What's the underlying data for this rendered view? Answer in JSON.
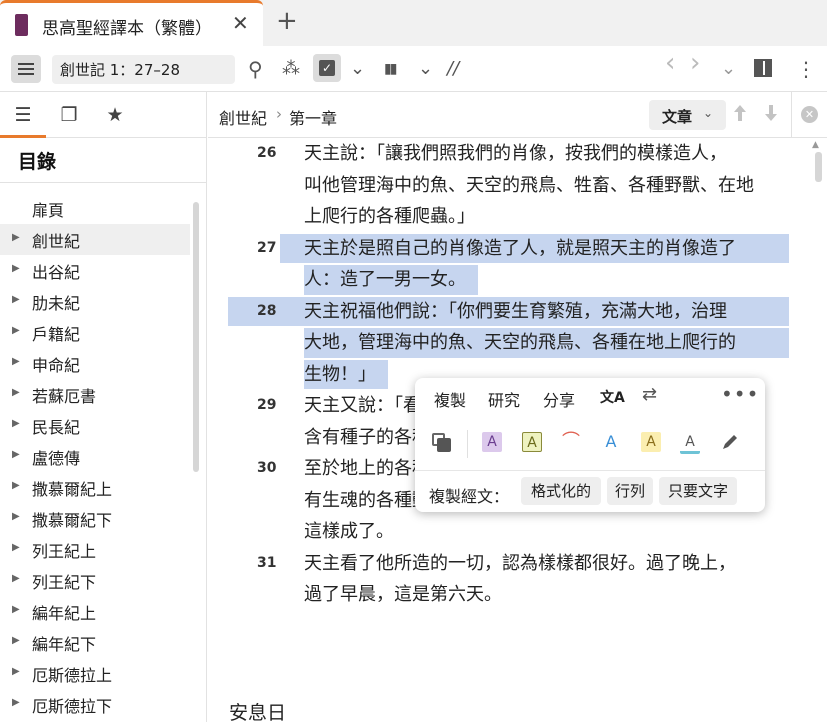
{
  "tab": {
    "title": "思高聖經譯本（繁體）",
    "close": "✕",
    "new": "+"
  },
  "toolbar": {
    "reference_value": "創世記 1：27–28",
    "search_icon": "⚲",
    "visual_icon": "⁂",
    "check_icon": "✓",
    "dropdown_icon": "⌄",
    "parallel_icon": "▮▮",
    "interlinear_label": "//",
    "back_icon": "‹",
    "forward_icon": "›",
    "more_icon": "⋮"
  },
  "sidebar": {
    "tabs": [
      {
        "name": "toc",
        "glyph": "☰"
      },
      {
        "name": "copies",
        "glyph": "❐"
      },
      {
        "name": "favorites",
        "glyph": "★"
      }
    ],
    "title": "目錄",
    "items": [
      {
        "label": "扉頁",
        "expandable": false,
        "selected": false
      },
      {
        "label": "創世紀",
        "expandable": true,
        "selected": true
      },
      {
        "label": "出谷紀",
        "expandable": true,
        "selected": false
      },
      {
        "label": "肋未紀",
        "expandable": true,
        "selected": false
      },
      {
        "label": "戶籍紀",
        "expandable": true,
        "selected": false
      },
      {
        "label": "申命紀",
        "expandable": true,
        "selected": false
      },
      {
        "label": "若蘇厄書",
        "expandable": true,
        "selected": false
      },
      {
        "label": "民長紀",
        "expandable": true,
        "selected": false
      },
      {
        "label": "盧德傳",
        "expandable": true,
        "selected": false
      },
      {
        "label": "撒慕爾紀上",
        "expandable": true,
        "selected": false
      },
      {
        "label": "撒慕爾紀下",
        "expandable": true,
        "selected": false
      },
      {
        "label": "列王紀上",
        "expandable": true,
        "selected": false
      },
      {
        "label": "列王紀下",
        "expandable": true,
        "selected": false
      },
      {
        "label": "編年紀上",
        "expandable": true,
        "selected": false
      },
      {
        "label": "編年紀下",
        "expandable": true,
        "selected": false
      },
      {
        "label": "厄斯德拉上",
        "expandable": true,
        "selected": false
      },
      {
        "label": "厄斯德拉下",
        "expandable": true,
        "selected": false
      }
    ]
  },
  "reader": {
    "breadcrumb_book": "創世紀",
    "breadcrumb_sep": "›",
    "breadcrumb_chapter": "第一章",
    "view_type": "文章",
    "verses": [
      {
        "num": "26",
        "lines": [
          "天主說：「讓我們照我們的肖像，按我們的模樣造人，",
          "叫他管理海中的魚、天空的飛鳥、牲畜、各種野獸、在地",
          "上爬行的各種爬蟲。」"
        ],
        "highlight": false
      },
      {
        "num": "27",
        "lines": [
          "天主於是照自己的肖像造了人，就是照天主的肖像造了",
          "人：造了一男一女。"
        ],
        "highlight": true
      },
      {
        "num": "28",
        "lines": [
          "天主祝福他們說：「你們要生育繁殖，充滿大地，治理",
          "大地，管理海中的魚、天空的飛鳥、各種在地上爬行的",
          "生物！」"
        ],
        "highlight": true
      },
      {
        "num": "29",
        "lines": [
          "天主又說：「看，全地面上結種子的各種蔬菜，在果內",
          "含有種子的各種果樹，我都給你們作食物；"
        ],
        "highlight": false
      },
      {
        "num": "30",
        "lines": [
          "至於地上的各種野獸，天空的各種飛鳥，在地上爬行",
          "有生魂的各種動物，我把一切青草給牠們作食物。」事就",
          "這樣成了。"
        ],
        "highlight": false
      },
      {
        "num": "31",
        "lines": [
          "天主看了他所造的一切，認為樣樣都很好。過了晚上，",
          "過了早晨，這是第六天。"
        ],
        "highlight": false
      }
    ],
    "section_heading": "安息日"
  },
  "popup": {
    "copy": "複製",
    "research": "研究",
    "share": "分享",
    "translate_icon": "文A",
    "swap_icon": "⇄",
    "more_icon": "•••",
    "highlights": [
      "A",
      "A",
      "⌒",
      "A",
      "A",
      "A"
    ],
    "copy_verse_label": "複製經文：",
    "formatted": "格式化的",
    "lines": "行列",
    "text_only": "只要文字"
  },
  "colors": {
    "accent": "#e87a2c",
    "highlight": "#c6d5ef",
    "book_icon": "#6d2c5e"
  }
}
